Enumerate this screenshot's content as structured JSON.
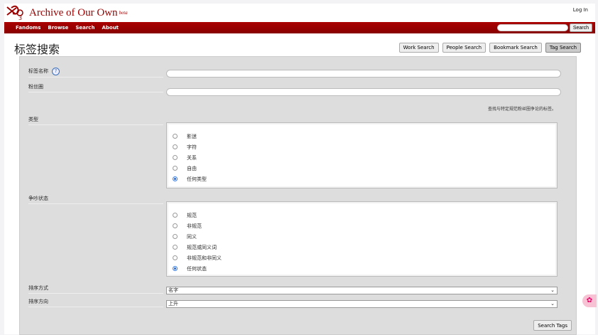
{
  "header": {
    "site_name": "Archive of Our Own",
    "beta": "beta",
    "login": "Log In"
  },
  "nav": {
    "items": [
      "Fandoms",
      "Browse",
      "Search",
      "About"
    ],
    "search_button": "Search"
  },
  "page_title": "标签搜索",
  "tabs": [
    "Work Search",
    "People Search",
    "Bookmark Search",
    "Tag Search"
  ],
  "form": {
    "tag_name_label": "标签名称",
    "help": "?",
    "fandom_label": "粉丝圈",
    "fandom_hint": "查找与特定规范粉丝圈争论的标签。",
    "type_label": "类型",
    "type_options": [
      "影迷",
      "字符",
      "关系",
      "自由",
      "任何类型"
    ],
    "type_selected": 4,
    "status_label": "争吵状态",
    "status_options": [
      "规范",
      "非规范",
      "同义",
      "规范或同义词",
      "非规范和非同义",
      "任何状态"
    ],
    "status_selected": 5,
    "sort_by_label": "排序方式",
    "sort_by_value": "名字",
    "sort_dir_label": "排序方向",
    "sort_dir_value": "上升",
    "submit": "Search Tags"
  }
}
